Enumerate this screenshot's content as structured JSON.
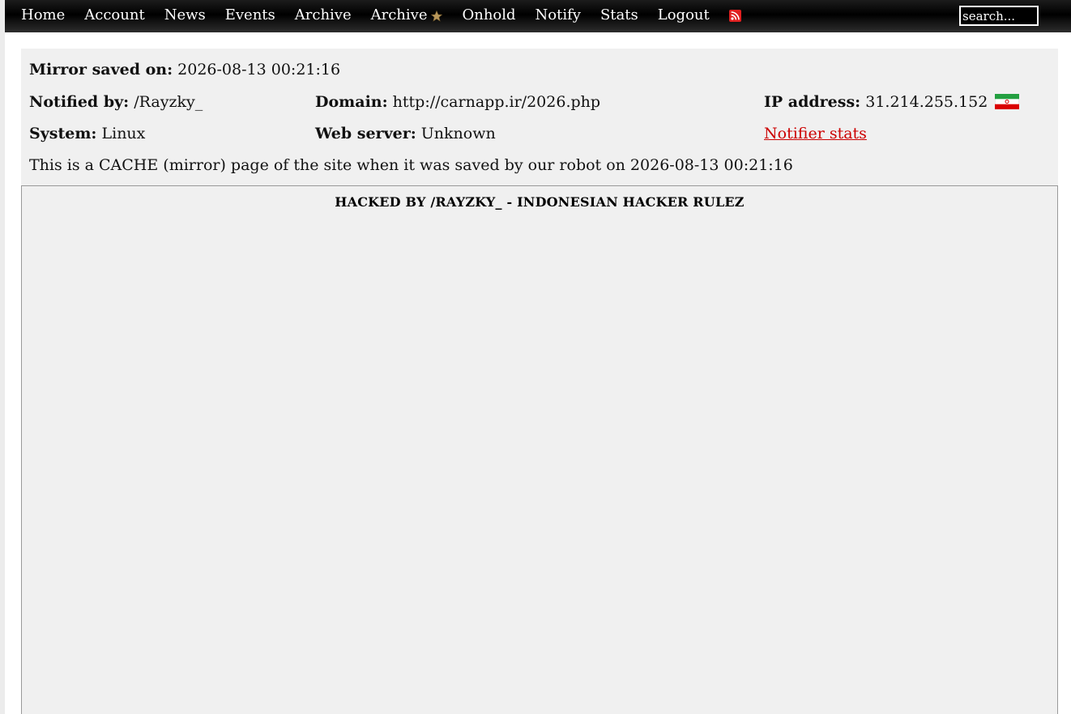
{
  "nav": {
    "items": [
      {
        "label": "Home"
      },
      {
        "label": "Account"
      },
      {
        "label": "News"
      },
      {
        "label": "Events"
      },
      {
        "label": "Archive"
      },
      {
        "label": "Archive",
        "icon": "star-icon"
      },
      {
        "label": "Onhold"
      },
      {
        "label": "Notify"
      },
      {
        "label": "Stats"
      },
      {
        "label": "Logout"
      }
    ],
    "rss_icon": "rss-icon",
    "search_placeholder": "search..."
  },
  "info": {
    "mirror_saved_label": "Mirror saved on:",
    "mirror_saved_value": "2026-08-13 00:21:16",
    "notified_by_label": "Notified by:",
    "notified_by_value": "/Rayzky_",
    "domain_label": "Domain:",
    "domain_value": "http://carnapp.ir/2026.php",
    "ip_label": "IP address:",
    "ip_value": "31.214.255.152",
    "flag_icon": "iran-flag-icon",
    "system_label": "System:",
    "system_value": "Linux",
    "web_server_label": "Web server:",
    "web_server_value": "Unknown",
    "notifier_stats_link": "Notifier stats",
    "cache_notice": "This is a CACHE (mirror) page of the site when it was saved by our robot on 2026-08-13 00:21:16"
  },
  "mirror": {
    "title": "HACKED BY /RAYZKY_ - INDONESIAN HACKER RULEZ"
  },
  "colors": {
    "link_red": "#cc0000",
    "panel_bg": "#f0f0f0",
    "nav_bg": "#000000"
  }
}
